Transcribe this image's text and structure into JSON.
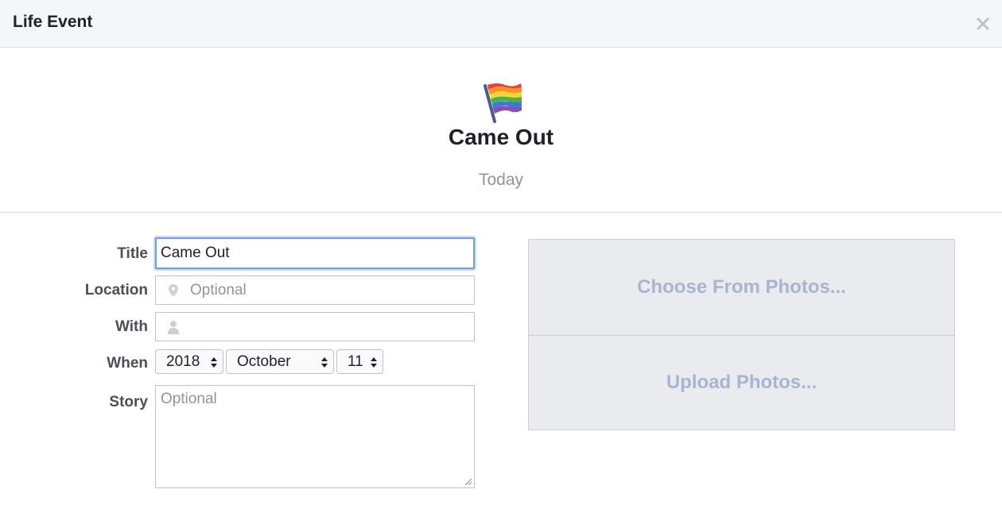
{
  "dialog": {
    "title": "Life Event",
    "close_icon": "close-icon"
  },
  "event": {
    "icon": "rainbow-flag-icon",
    "title": "Came Out",
    "date_label": "Today"
  },
  "form": {
    "title_label": "Title",
    "title_value": "Came Out",
    "location_label": "Location",
    "location_placeholder": "Optional",
    "location_icon": "location-pin-icon",
    "with_label": "With",
    "with_placeholder": "",
    "with_icon": "person-icon",
    "when_label": "When",
    "year": "2018",
    "month": "October",
    "day": "11",
    "story_label": "Story",
    "story_placeholder": "Optional"
  },
  "photos": {
    "choose_label": "Choose From Photos...",
    "upload_label": "Upload Photos..."
  }
}
